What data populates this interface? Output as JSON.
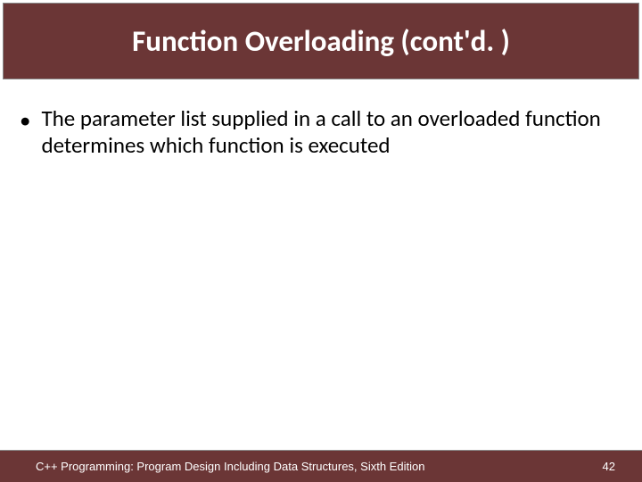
{
  "title": "Function Overloading (cont'd. )",
  "bullets": [
    {
      "text": "The parameter list supplied in a call to an overloaded function determines which function is executed"
    }
  ],
  "footer": {
    "reference": "C++ Programming: Program Design Including Data Structures, Sixth Edition",
    "page_number": "42"
  }
}
